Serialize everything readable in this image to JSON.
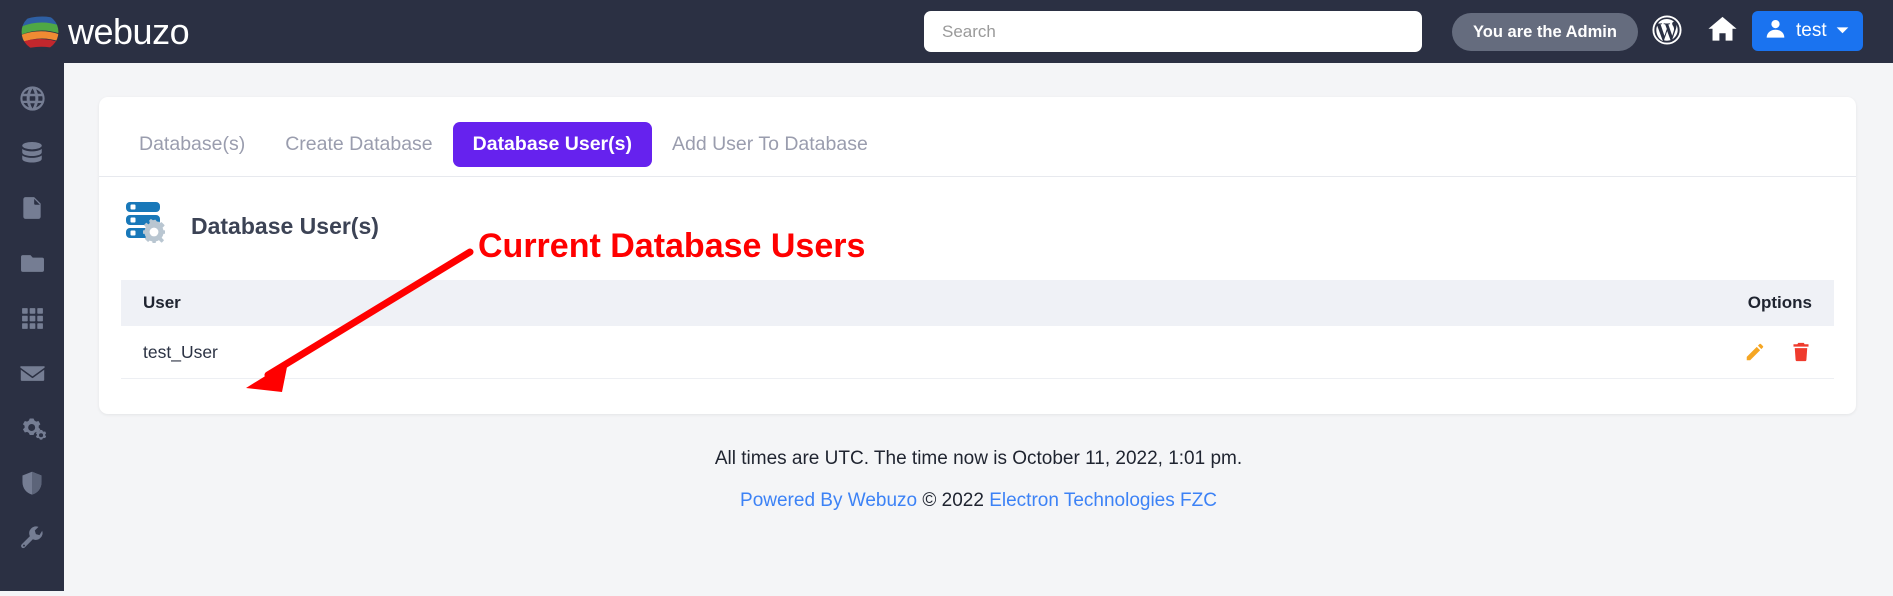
{
  "header": {
    "brand_name": "webuzo",
    "brand_logo_icon": "webuzo-globe-logo",
    "search": {
      "placeholder": "Search",
      "value": ""
    },
    "admin_pill_label": "You are the Admin",
    "wordpress_icon": "wordpress-icon",
    "home_icon": "home-icon",
    "user": {
      "name": "test",
      "avatar_icon": "user-avatar-icon",
      "caret_icon": "chevron-down-icon"
    }
  },
  "sidebar": {
    "items": [
      {
        "icon": "globe-icon",
        "name": "sidebar-item-globe"
      },
      {
        "icon": "database-icon",
        "name": "sidebar-item-database"
      },
      {
        "icon": "file-icon",
        "name": "sidebar-item-file"
      },
      {
        "icon": "folder-icon",
        "name": "sidebar-item-folder"
      },
      {
        "icon": "grid-icon",
        "name": "sidebar-item-apps"
      },
      {
        "icon": "envelope-icon",
        "name": "sidebar-item-mail"
      },
      {
        "icon": "gears-icon",
        "name": "sidebar-item-settings"
      },
      {
        "icon": "shield-icon",
        "name": "sidebar-item-security"
      },
      {
        "icon": "wrench-icon",
        "name": "sidebar-item-tools"
      }
    ]
  },
  "tabs": [
    {
      "label": "Database(s)",
      "active": false
    },
    {
      "label": "Create Database",
      "active": false
    },
    {
      "label": "Database User(s)",
      "active": true
    },
    {
      "label": "Add User To Database",
      "active": false
    }
  ],
  "section": {
    "title": "Database User(s)",
    "icon": "database-server-gear-icon"
  },
  "table": {
    "columns": [
      "User",
      "Options"
    ],
    "rows": [
      {
        "user": "test_User",
        "actions": [
          {
            "name": "edit-icon",
            "label": "Edit"
          },
          {
            "name": "delete-icon",
            "label": "Delete"
          }
        ]
      }
    ]
  },
  "footer": {
    "time_notice": "All times are UTC. The time now is October 11, 2022, 1:01 pm.",
    "powered_by_label": "Powered By Webuzo",
    "copyright": " © 2022 ",
    "company_label": "Electron Technologies FZC"
  },
  "annotation": {
    "text": "Current Database Users",
    "color": "#ff0000"
  },
  "colors": {
    "topbar": "#2b3043",
    "page_bg": "#f4f5f7",
    "active_tab": "#6622ee",
    "user_btn": "#1a73f0",
    "admin_pill": "#656c7e",
    "link": "#3c82f6",
    "edit_icon": "#f5a623",
    "delete_icon": "#ef3b2d",
    "annotation": "#ff0000"
  }
}
